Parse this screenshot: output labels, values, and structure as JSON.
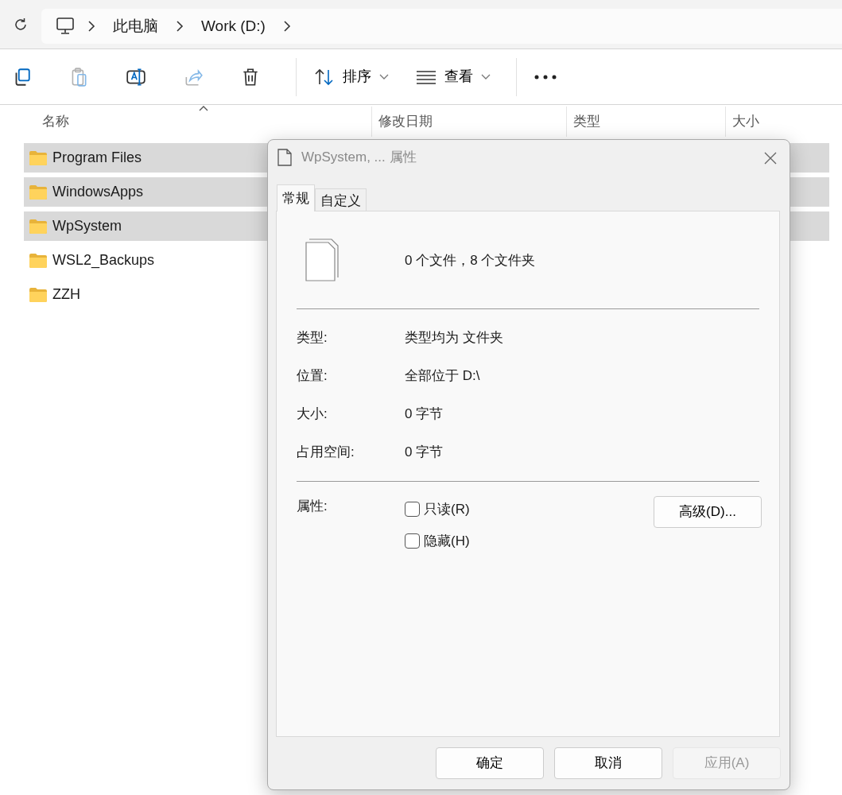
{
  "address": {
    "crumbs": [
      "此电脑",
      "Work (D:)"
    ]
  },
  "toolbar": {
    "icons": [
      {
        "kind": "copy",
        "disabled": false
      },
      {
        "kind": "paste",
        "disabled": true
      },
      {
        "kind": "rename",
        "disabled": false
      },
      {
        "kind": "share",
        "disabled": true
      },
      {
        "kind": "delete",
        "disabled": false
      }
    ],
    "sort": "排序",
    "view": "查看"
  },
  "columns": [
    "名称",
    "修改日期",
    "类型",
    "大小"
  ],
  "rows": [
    {
      "name": "Program Files",
      "selected": true
    },
    {
      "name": "WindowsApps",
      "selected": true
    },
    {
      "name": "WpSystem",
      "selected": true
    },
    {
      "name": "WSL2_Backups",
      "selected": false
    },
    {
      "name": "ZZH",
      "selected": false
    }
  ],
  "dialog": {
    "title": "WpSystem, ... 属性",
    "tabs": [
      {
        "label": "常规",
        "selected": true
      },
      {
        "label": "自定义",
        "selected": false
      }
    ],
    "summary": "0 个文件，8 个文件夹",
    "properties": [
      {
        "label": "类型:",
        "value": "类型均为 文件夹"
      },
      {
        "label": "位置:",
        "value": "全部位于 D:\\"
      },
      {
        "label": "大小:",
        "value": "0 字节"
      },
      {
        "label": "占用空间:",
        "value": "0 字节"
      }
    ],
    "attributes_label": "属性:",
    "checkboxes": [
      {
        "label": "只读(R)",
        "checked": false
      },
      {
        "label": "隐藏(H)",
        "checked": false
      }
    ],
    "advanced_button": "高级(D)...",
    "buttons": [
      {
        "label": "确定",
        "disabled": false
      },
      {
        "label": "取消",
        "disabled": false
      },
      {
        "label": "应用(A)",
        "disabled": true
      }
    ]
  }
}
